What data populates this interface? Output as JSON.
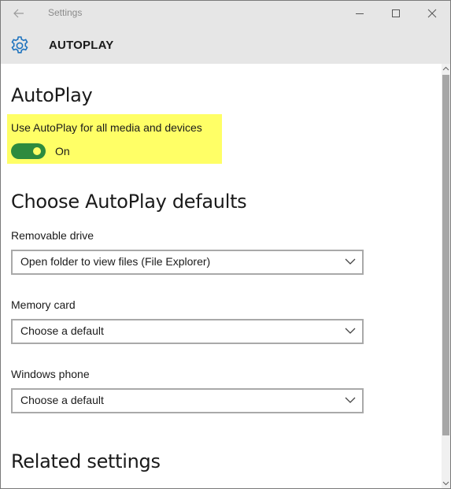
{
  "window": {
    "title": "Settings"
  },
  "header": {
    "icon": "gear-icon",
    "title": "AUTOPLAY"
  },
  "autoplay": {
    "heading": "AutoPlay",
    "toggle_label": "Use AutoPlay for all media and devices",
    "toggle_state": "On",
    "toggle_on": true,
    "highlight_color": "#ffff66",
    "toggle_color": "#2e8b3e"
  },
  "defaults": {
    "heading": "Choose AutoPlay defaults",
    "removable_drive": {
      "label": "Removable drive",
      "value": "Open folder to view files (File Explorer)"
    },
    "memory_card": {
      "label": "Memory card",
      "value": "Choose a default"
    },
    "windows_phone": {
      "label": "Windows phone",
      "value": "Choose a default"
    }
  },
  "related": {
    "heading": "Related settings"
  },
  "colors": {
    "accent": "#1e73be",
    "chrome": "#e6e6e6"
  }
}
